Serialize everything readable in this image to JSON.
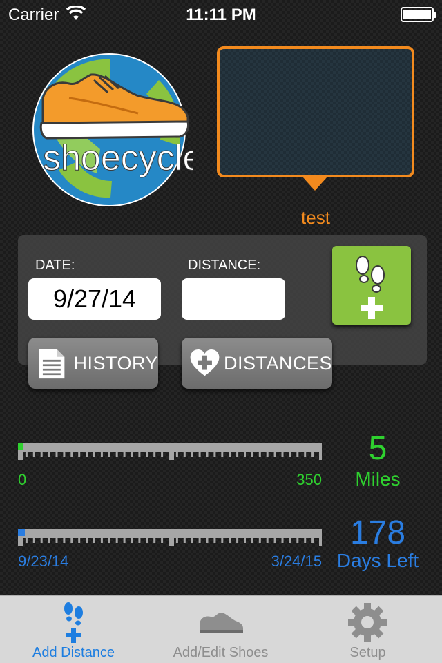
{
  "status_bar": {
    "carrier": "Carrier",
    "time": "11:11 PM"
  },
  "logo": {
    "text": "shoecycle"
  },
  "shoe": {
    "name": "test"
  },
  "entry": {
    "date_label": "DATE:",
    "date_value": "9/27/14",
    "distance_label": "DISTANCE:",
    "distance_value": ""
  },
  "buttons": {
    "history": "HISTORY",
    "distances": "DISTANCES"
  },
  "distance_progress": {
    "min": "0",
    "max": "350",
    "value": "5",
    "unit": "Miles",
    "fraction": 0.014,
    "color": "#2fd12f"
  },
  "time_progress": {
    "start": "9/23/14",
    "end": "3/24/15",
    "value": "178",
    "unit": "Days Left",
    "fraction": 0.022,
    "color": "#2a7de1"
  },
  "tabs": [
    {
      "label": "Add Distance",
      "active": true
    },
    {
      "label": "Add/Edit Shoes",
      "active": false
    },
    {
      "label": "Setup",
      "active": false
    }
  ],
  "colors": {
    "accent_orange": "#f28a1e",
    "accent_green": "#8ac340",
    "tab_active": "#1e7ee0",
    "tab_inactive": "#8e8e8e"
  }
}
